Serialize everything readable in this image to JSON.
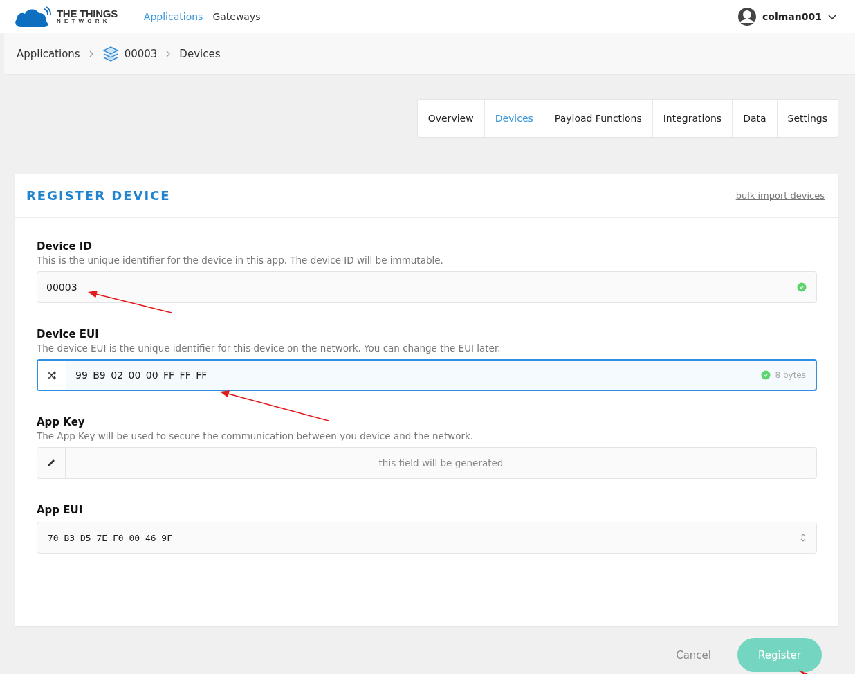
{
  "header": {
    "logo": {
      "line1": "THE THINGS",
      "line2": "NETWORK"
    },
    "nav": [
      {
        "label": "Applications",
        "selected": true
      },
      {
        "label": "Gateways",
        "selected": false
      }
    ],
    "user": {
      "name": "colman001"
    }
  },
  "breadcrumbs": [
    {
      "label": "Applications",
      "kind": "text"
    },
    {
      "label": "00003",
      "kind": "app"
    },
    {
      "label": "Devices",
      "kind": "text"
    }
  ],
  "tabs": [
    {
      "label": "Overview",
      "selected": false
    },
    {
      "label": "Devices",
      "selected": true
    },
    {
      "label": "Payload Functions",
      "selected": false
    },
    {
      "label": "Integrations",
      "selected": false
    },
    {
      "label": "Data",
      "selected": false
    },
    {
      "label": "Settings",
      "selected": false
    }
  ],
  "form": {
    "title": "REGISTER DEVICE",
    "link": "bulk import devices",
    "fields": [
      {
        "kind": "text",
        "label": "Device ID",
        "description": "This is the unique identifier for the device in this app. The device ID will be immutable.",
        "value": "00003",
        "valid": true,
        "focused": false
      },
      {
        "kind": "eui",
        "label": "Device EUI",
        "description": "The device EUI is the unique identifier for this device on the network. You can change the EUI later.",
        "value": "99 B9 02 00 00 FF FF FF",
        "valid": true,
        "focused": true,
        "hint": "8 bytes"
      },
      {
        "kind": "generated",
        "label": "App Key",
        "description": "The App Key will be used to secure the communication between you device and the network.",
        "placeholder": "this field will be generated",
        "focused": false
      },
      {
        "kind": "select",
        "label": "App EUI",
        "value": "70 B3 D5 7E F0 00 46 9F",
        "focused": false
      }
    ]
  },
  "actions": {
    "cancel": "Cancel",
    "submit": {
      "label": "Register",
      "disabled": true
    }
  }
}
